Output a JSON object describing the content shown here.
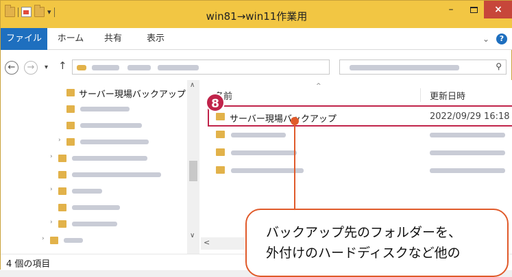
{
  "titlebar": {
    "title": "win81→win11作業用",
    "minimize": "–",
    "close": "×"
  },
  "ribbon": {
    "tabs": [
      "ファイル",
      "ホーム",
      "共有",
      "表示"
    ],
    "help": "?"
  },
  "nav_pane": {
    "items": [
      {
        "label": "サーバー現場バックアップ"
      }
    ]
  },
  "content": {
    "headers": {
      "name": "名前",
      "date": "更新日時"
    },
    "rows": [
      {
        "name": "サーバー現場バックアップ",
        "date": "2022/09/29 16:18"
      }
    ]
  },
  "status_bar": {
    "item_count": "4 個の項目"
  },
  "annotation": {
    "step": "8",
    "callout_lines": [
      "バックアップ先のフォルダーを、",
      "外付けのハードディスクなど他の"
    ]
  },
  "colors": {
    "titlebar": "#f2c643",
    "file_tab": "#1e6fbf",
    "close_button": "#c7463a",
    "highlight": "#c0234a",
    "callout": "#e05a2a",
    "folder": "#e2b24a"
  }
}
